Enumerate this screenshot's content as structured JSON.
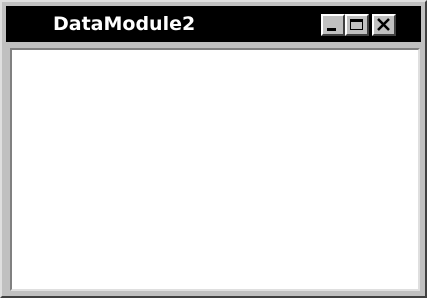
{
  "window": {
    "title": "DataModule2",
    "minimize_icon": "minimize-icon",
    "maximize_icon": "maximize-icon",
    "close_icon": "close-icon",
    "colors": {
      "titlebar": "#000000",
      "title_text": "#ffffff",
      "frame": "#c0c0c0",
      "client": "#ffffff"
    }
  }
}
